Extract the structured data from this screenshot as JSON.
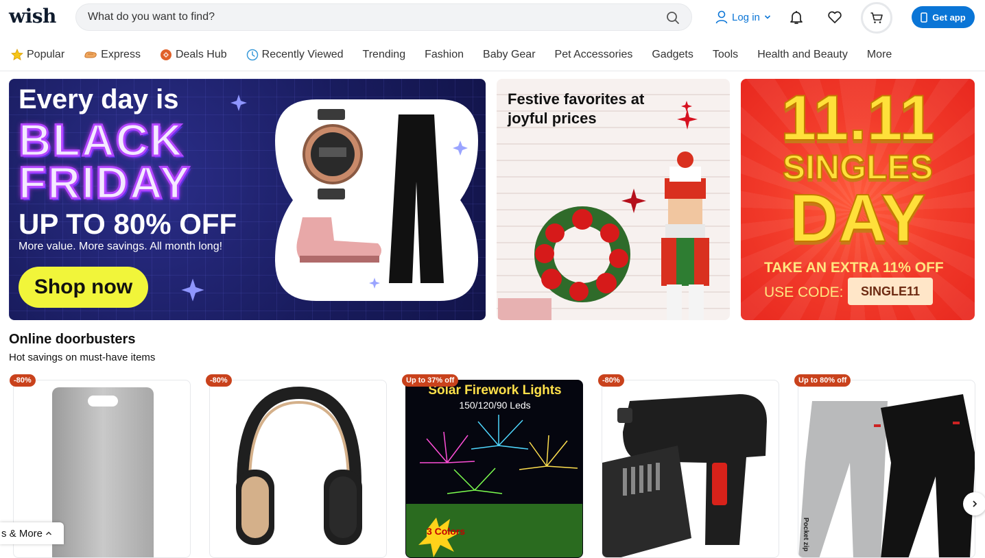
{
  "header": {
    "logo": "wish",
    "search_placeholder": "What do you want to find?",
    "login_label": "Log in",
    "get_app_label": "Get app"
  },
  "nav": {
    "items": [
      {
        "label": "Popular",
        "icon": "star-icon"
      },
      {
        "label": "Express",
        "icon": "express-icon"
      },
      {
        "label": "Deals Hub",
        "icon": "deals-icon"
      },
      {
        "label": "Recently Viewed",
        "icon": "clock-icon"
      },
      {
        "label": "Trending"
      },
      {
        "label": "Fashion"
      },
      {
        "label": "Baby Gear"
      },
      {
        "label": "Pet Accessories"
      },
      {
        "label": "Gadgets"
      },
      {
        "label": "Tools"
      },
      {
        "label": "Health and Beauty"
      },
      {
        "label": "More"
      }
    ]
  },
  "banners": {
    "black_friday": {
      "line1": "Every day is",
      "line2": "BLACK",
      "line3": "FRIDAY",
      "offer": "UP TO 80% OFF",
      "sub": "More value. More savings. All month long!",
      "button": "Shop now"
    },
    "festive": {
      "title": "Festive favorites at joyful prices"
    },
    "singles": {
      "line1": "11.11",
      "line2": "SINGLES",
      "line3": "DAY",
      "extra": "TAKE AN EXTRA 11% OFF",
      "code_label": "USE CODE:",
      "code": "SINGLE11"
    }
  },
  "doorbusters": {
    "title": "Online doorbusters",
    "subtitle": "Hot savings on must-have items",
    "cards": [
      {
        "badge": "-80%",
        "product": "cutting-board"
      },
      {
        "badge": "-80%",
        "product": "headphones"
      },
      {
        "badge": "Up to 37% off",
        "product": "solar-firework-lights",
        "img_title": "Solar Firework Lights",
        "img_sub": "150/120/90 Leds",
        "img_tag": "3 Colors"
      },
      {
        "badge": "-80%",
        "product": "cordless-drill"
      },
      {
        "badge": "Up to 80% off",
        "product": "jogger-pants",
        "img_tag": "Pocket zip"
      }
    ]
  },
  "floating": {
    "label": "s & More"
  },
  "colors": {
    "brand_blue": "#0a75d6",
    "badge_red": "#c9421c",
    "shop_now_yellow": "#f1f53a",
    "singles_yellow": "#ffe03a"
  }
}
